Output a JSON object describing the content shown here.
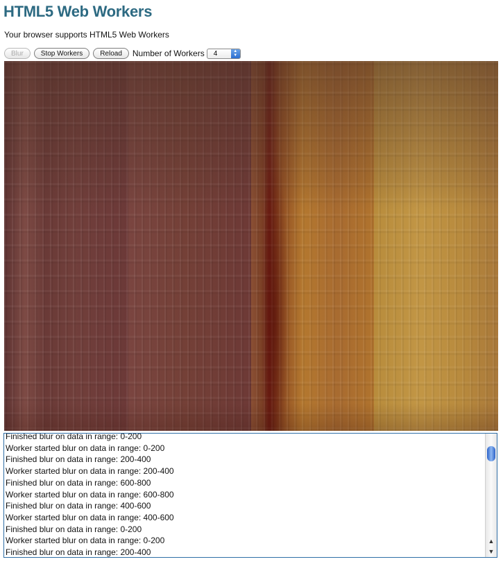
{
  "page": {
    "title": "HTML5 Web Workers",
    "support_message": "Your browser supports HTML5 Web Workers"
  },
  "toolbar": {
    "blur_label": "Blur",
    "stop_label": "Stop Workers",
    "reload_label": "Reload",
    "workers_label": "Number of Workers",
    "workers_value": "4"
  },
  "canvas": {
    "description_icon": "blurred-image"
  },
  "log": {
    "lines": [
      "Finished blur on data in range: 0-200",
      "Worker started blur on data in range: 0-200",
      "Finished blur on data in range: 200-400",
      "Worker started blur on data in range: 200-400",
      "Finished blur on data in range: 600-800",
      "Worker started blur on data in range: 600-800",
      "Finished blur on data in range: 400-600",
      "Worker started blur on data in range: 400-600",
      "Finished blur on data in range: 0-200",
      "Worker started blur on data in range: 0-200",
      "Finished blur on data in range: 200-400"
    ]
  },
  "colors": {
    "title": "#2d6a82",
    "log_border": "#2e6ea6"
  }
}
